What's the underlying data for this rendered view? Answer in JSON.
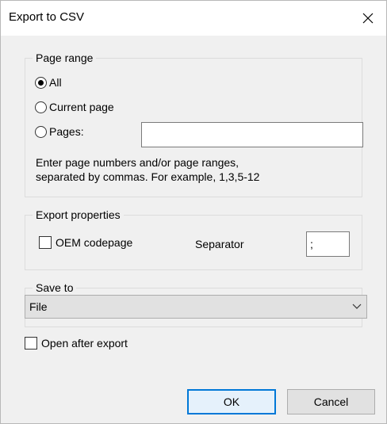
{
  "dialog": {
    "title": "Export to CSV"
  },
  "page_range": {
    "legend": "Page range",
    "options": [
      "All",
      "Current page",
      "Pages:"
    ],
    "selected": "All",
    "pages_value": "",
    "hint_line1": "Enter page numbers and/or page ranges,",
    "hint_line2": "separated by commas. For example, 1,3,5-12"
  },
  "export_properties": {
    "legend": "Export properties",
    "oem_codepage_label": "OEM codepage",
    "oem_codepage_checked": false,
    "separator_label": "Separator",
    "separator_value": ";"
  },
  "save_to": {
    "legend": "Save to",
    "selected": "File"
  },
  "open_after_export": {
    "label": "Open after export",
    "checked": false
  },
  "buttons": {
    "ok": "OK",
    "cancel": "Cancel"
  },
  "colors": {
    "accent": "#0078d7",
    "window_background": "#f0f0f0"
  },
  "icons": {
    "close": "close-icon",
    "dropdown": "chevron-down-icon"
  }
}
